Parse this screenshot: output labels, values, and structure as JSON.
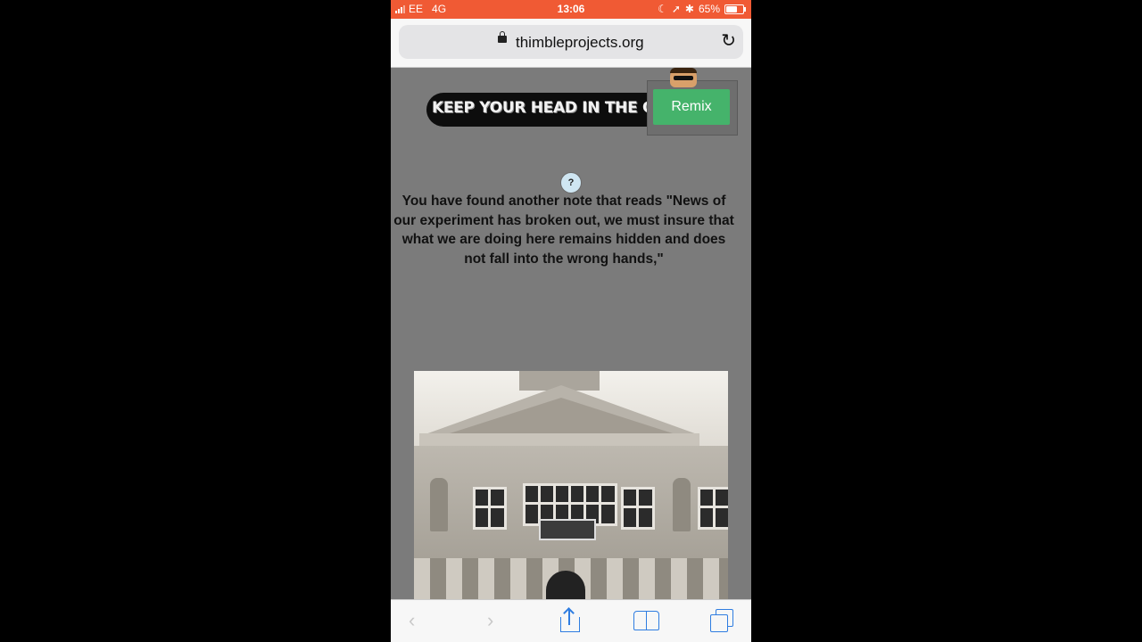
{
  "status_bar": {
    "carrier": "EE",
    "network": "4G",
    "time": "13:06",
    "battery": "65%",
    "battery_level": 0.65,
    "background_color": "#f05a34"
  },
  "browser": {
    "url": "thimbleprojects.org",
    "lock_icon": "lock-icon",
    "reload_icon": "reload-icon"
  },
  "page": {
    "banner_text": "KEEP YOUR HEAD IN THE GA",
    "remix_label": "Remix",
    "remix_color": "#45b36b",
    "help_label": "?",
    "story_text": "You have found another note that reads \"News of our experiment has broken out, we must insure that what we are doing here remains hidden and does not fall into the wrong hands,\"",
    "background_color": "#7b7b7b"
  },
  "toolbar": {
    "icons": [
      "back-icon",
      "forward-icon",
      "share-icon",
      "bookmarks-icon",
      "tabs-icon"
    ],
    "accent_color": "#2f7de1"
  }
}
